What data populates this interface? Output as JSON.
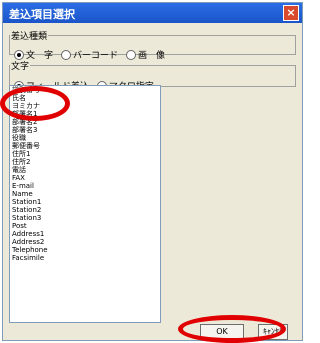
{
  "window": {
    "title": "差込項目選択"
  },
  "kind_group": {
    "legend": "差込種類",
    "options": [
      "文　字",
      "バーコード",
      "画　像"
    ],
    "selected": 0
  },
  "text_group": {
    "legend": "文字",
    "options": [
      "フィールド差込",
      "マクロ指定"
    ],
    "selected": 0
  },
  "fields": [
    "識別番号",
    "氏名",
    "ヨミカナ",
    "部署名1",
    "部署名2",
    "部署名3",
    "役職",
    "郵便番号",
    "住所1",
    "住所2",
    "電話",
    "FAX",
    "E-mail",
    "Name",
    "Station1",
    "Station2",
    "Station3",
    "Post",
    "Address1",
    "Address2",
    "Telephone",
    "Facsimile"
  ],
  "buttons": {
    "ok": "OK",
    "cancel": "ｷｬﾝｾﾙ"
  },
  "colors": {
    "annotation": "#e00000",
    "titlebar": "#1a54c8"
  }
}
